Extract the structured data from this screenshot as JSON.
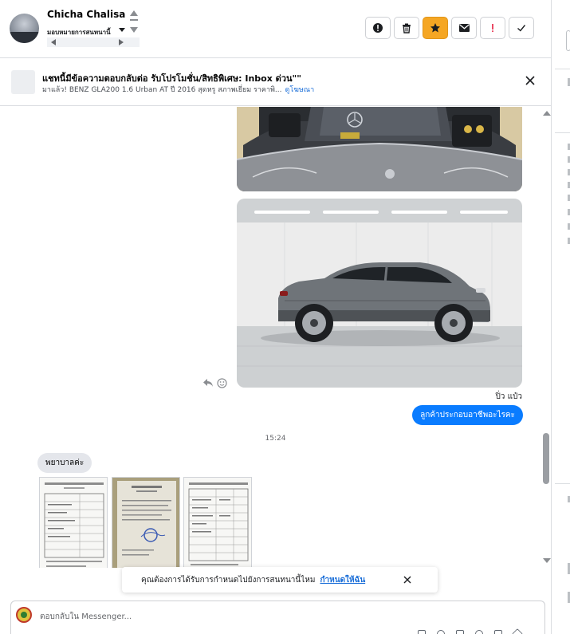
{
  "header": {
    "contact_name": "Chicha Chalisa",
    "assign_label": "มอบหมายการสนทนานี้",
    "actions": [
      {
        "name": "report-spam",
        "icon": "exclamation-circle-icon"
      },
      {
        "name": "delete",
        "icon": "trash-icon"
      },
      {
        "name": "star",
        "icon": "star-icon",
        "active": true,
        "color": "#f5a623"
      },
      {
        "name": "mark-unread",
        "icon": "envelope-icon"
      },
      {
        "name": "flag",
        "icon": "exclamation-icon",
        "color": "#e41e3f"
      },
      {
        "name": "mark-done",
        "icon": "check-icon"
      }
    ]
  },
  "ad_banner": {
    "title": "แชทนี้มีข้อความตอบกลับต่อ รับโปรโมชั่น/สิทธิพิเศษ: Inbox ด่วน\"\"",
    "subtitle": "มาแล้ว! BENZ GLA200 1.6 Urban AT ปี 2016 สุดหรู สภาพเยี่ยม ราคาพิ...",
    "link_label": "ดูโฆษณา"
  },
  "messages": {
    "sender_name": "ปิ่ว แป๋ว",
    "outgoing_text": "ลูกค้าประกอบอาชีพอะไรคะ",
    "timestamp": "15:24",
    "incoming_text": "พยาบาลค่ะ",
    "outgoing_color": "#0a7cff"
  },
  "toast": {
    "text": "คุณต้องการได้รับการกำหนดไปยังการสนทนานี้ไหม",
    "link_label": "กำหนดให้ฉัน"
  },
  "composer": {
    "placeholder": "ตอบกลับใน Messenger..."
  }
}
